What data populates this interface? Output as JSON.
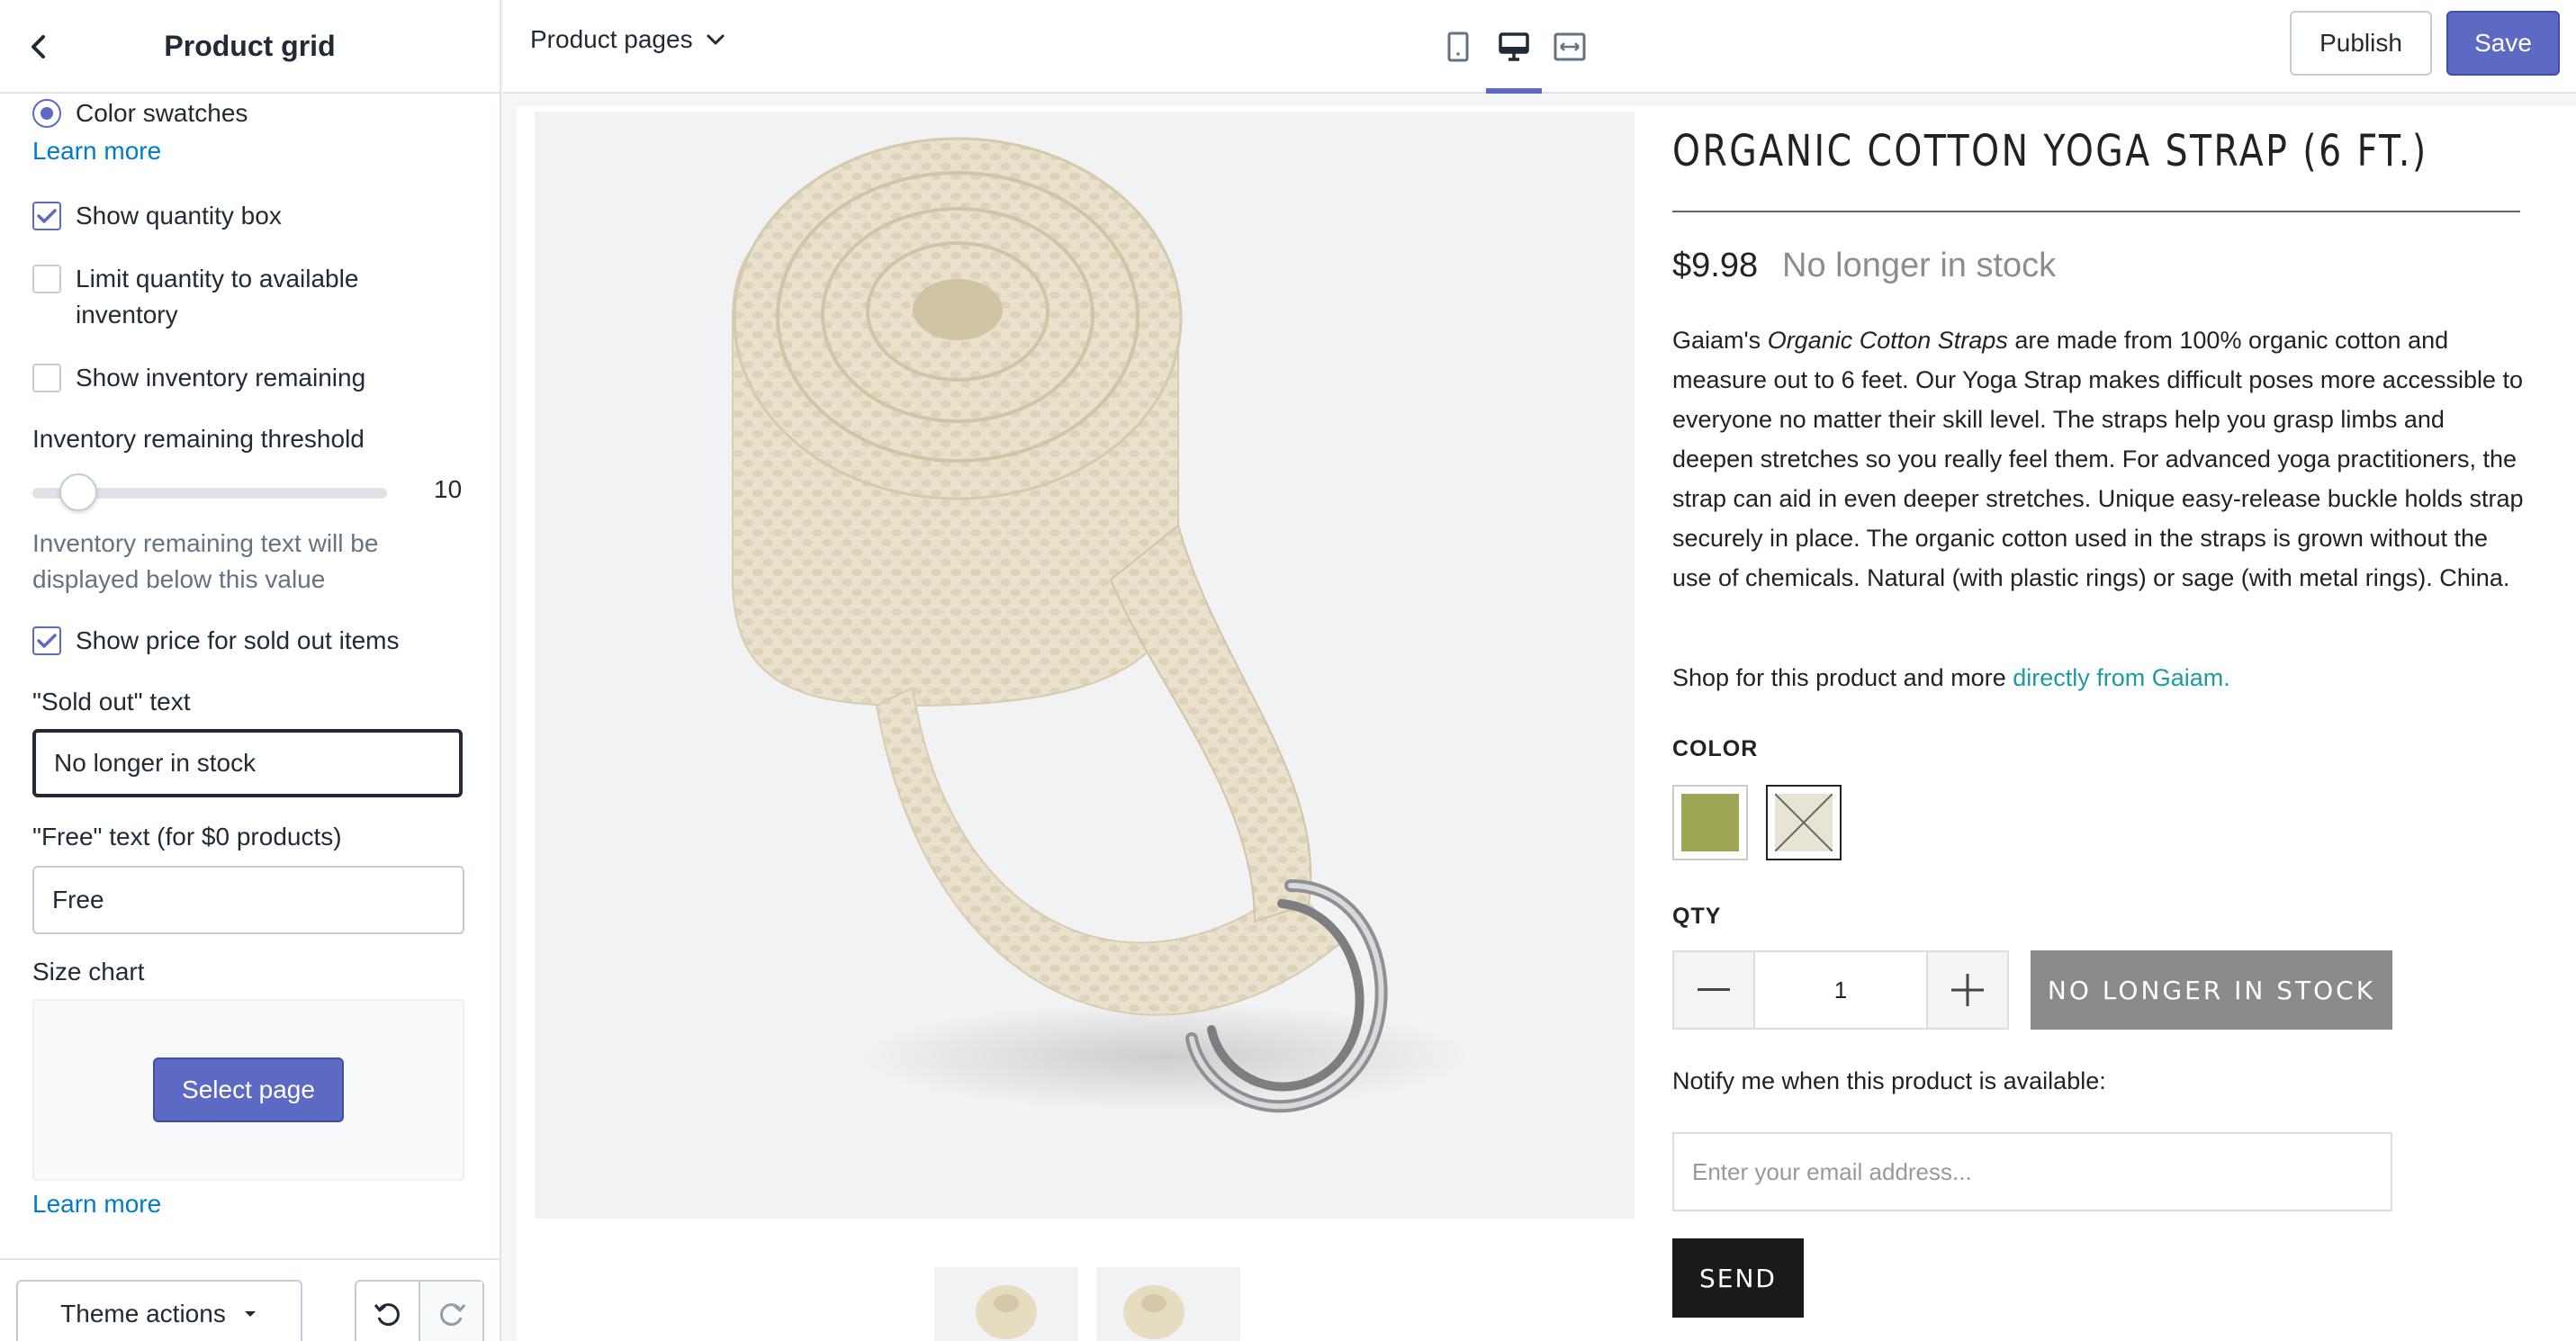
{
  "sidebar": {
    "title": "Product grid",
    "color_swatches_label": "Color swatches",
    "learn_more_1": "Learn more",
    "show_quantity_box": "Show quantity box",
    "limit_quantity": "Limit quantity to available inventory",
    "show_inventory_remaining": "Show inventory remaining",
    "inventory_threshold_label": "Inventory remaining threshold",
    "inventory_threshold_value": "10",
    "inventory_help": "Inventory remaining text will be displayed below this value",
    "show_price_sold_out": "Show price for sold out items",
    "sold_out_text_label": "\"Sold out\" text",
    "sold_out_text_value": "No longer in stock",
    "free_text_label": "\"Free\" text (for $0 products)",
    "free_text_value": "Free",
    "size_chart_label": "Size chart",
    "select_page": "Select page",
    "learn_more_2": "Learn more",
    "theme_actions": "Theme actions"
  },
  "topbar": {
    "page_select": "Product pages",
    "publish": "Publish",
    "save": "Save"
  },
  "product": {
    "title": "ORGANIC COTTON YOGA STRAP (6 FT.)",
    "price": "$9.98",
    "stock_status": "No longer in stock",
    "desc_pre": "Gaiam's ",
    "desc_em": "Organic Cotton Straps",
    "desc_post": " are made from 100% organic cotton and measure out to 6 feet. Our Yoga Strap makes difficult poses more accessible to everyone no matter their skill level. The straps help you grasp limbs and deepen stretches so you really feel them. For advanced yoga practitioners, the strap can aid in even deeper stretches. Unique easy-release buckle holds strap securely in place. The organic cotton used in the straps is grown without the use of chemicals. Natural (with plastic rings) or sage (with metal rings). China.",
    "shop_pre": "Shop for this product and more ",
    "shop_link": "directly from Gaiam.",
    "color_label": "COLOR",
    "qty_label": "QTY",
    "qty_value": "1",
    "oos_button": "NO LONGER IN STOCK",
    "notify_text": "Notify me when this product is available:",
    "email_placeholder": "Enter your email address...",
    "send": "SEND"
  },
  "colors": {
    "accent": "#5c6ac4",
    "link": "#007ace",
    "shop_link": "#1b9aa3",
    "oos_button": "#8a8a8a",
    "strap_natural": "#e9e1cc",
    "swatch_sage": "#9fa653"
  }
}
